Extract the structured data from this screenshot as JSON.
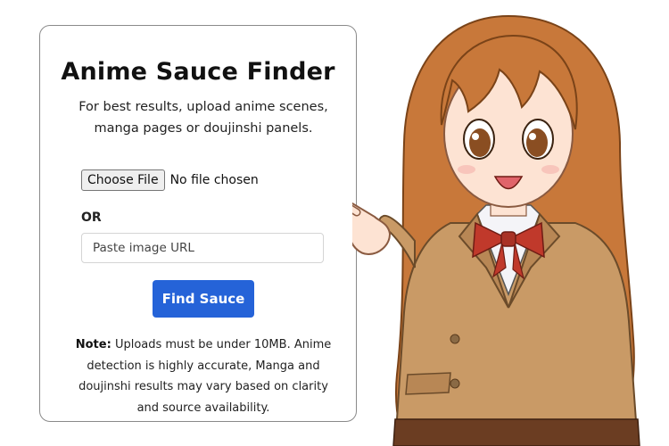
{
  "card": {
    "title": "Anime Sauce Finder",
    "subtitle": "For best results, upload anime scenes, manga pages or doujinshi panels.",
    "file_button_label": "Choose File",
    "file_status": "No file chosen",
    "or_label": "OR",
    "url_placeholder": "Paste image URL",
    "url_value": "",
    "submit_label": "Find Sauce",
    "note_label": "Note:",
    "note_text": "Uploads must be under 10MB. Anime detection is highly accurate, Manga and doujinshi results may vary based on clarity and source availability."
  },
  "colors": {
    "accent": "#2563d8",
    "card_border": "#8a8a8a",
    "hair": "#c8783a",
    "jacket": "#c99a66",
    "bow": "#c0392b"
  },
  "illustration": {
    "icon": "anime-girl-pointing-illustration"
  }
}
